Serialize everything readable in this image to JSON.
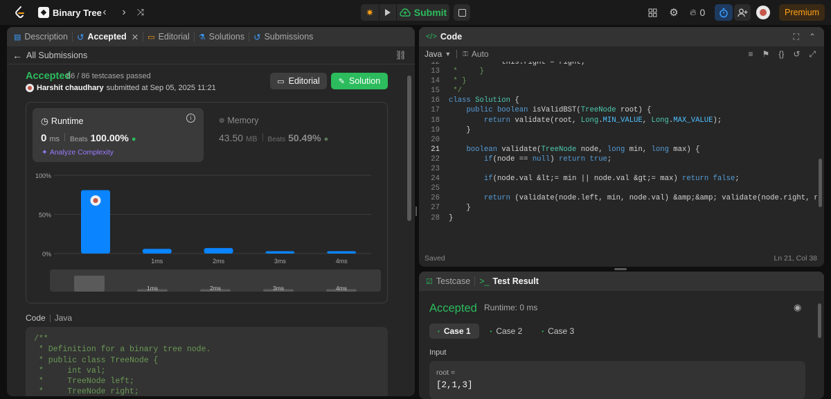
{
  "topbar": {
    "problem_title": "Binary Tree",
    "submit_label": "Submit",
    "streak_count": "0",
    "premium_label": "Premium"
  },
  "left_tabs": {
    "description": "Description",
    "accepted": "Accepted",
    "editorial": "Editorial",
    "solutions": "Solutions",
    "submissions": "Submissions"
  },
  "submission": {
    "back_label": "All Submissions",
    "status": "Accepted",
    "testcases": "86 / 86 testcases passed",
    "user_name": "Harshit chaudhary",
    "submitted_text": "submitted at Sep 05, 2025 11:21",
    "editorial_btn": "Editorial",
    "solution_btn": "Solution"
  },
  "runtime": {
    "label": "Runtime",
    "value": "0",
    "unit": "ms",
    "beats_label": "Beats",
    "beats_value": "100.00%",
    "analyze_label": "Analyze Complexity"
  },
  "memory": {
    "label": "Memory",
    "value": "43.50",
    "unit": "MB",
    "beats_label": "Beats",
    "beats_value": "50.49%"
  },
  "chart_data": {
    "type": "bar",
    "categories": [
      "0ms",
      "1ms",
      "2ms",
      "3ms",
      "4ms"
    ],
    "tick_labels": [
      "",
      "1ms",
      "2ms",
      "3ms",
      "4ms"
    ],
    "values": [
      81,
      6,
      7,
      3,
      3
    ],
    "y_ticks": [
      "100%",
      "50%",
      "0%"
    ],
    "ylim": [
      0,
      100
    ],
    "bar_color": "#0a84ff",
    "highlight_category": "0ms",
    "mini_bars": [
      20,
      3,
      3,
      3,
      3
    ],
    "mini_labels": [
      "",
      "1ms",
      "2ms",
      "3ms",
      "4ms"
    ]
  },
  "code_section": {
    "label": "Code",
    "lang": "Java",
    "lines": [
      "/**",
      " * Definition for a binary tree node.",
      " * public class TreeNode {",
      " *     int val;",
      " *     TreeNode left;",
      " *     TreeNode right;"
    ]
  },
  "editor": {
    "title": "Code",
    "language": "Java",
    "mode": "Auto",
    "partial_top": "            this.right = right;",
    "lines": [
      {
        "n": "13",
        "t": " *     }"
      },
      {
        "n": "14",
        "t": " * }"
      },
      {
        "n": "15",
        "t": " */"
      },
      {
        "n": "16",
        "t": "class Solution {"
      },
      {
        "n": "17",
        "t": "    public boolean isValidBST(TreeNode root) {"
      },
      {
        "n": "18",
        "t": "        return validate(root, Long.MIN_VALUE, Long.MAX_VALUE);"
      },
      {
        "n": "19",
        "t": "    }"
      },
      {
        "n": "20",
        "t": ""
      },
      {
        "n": "21",
        "t": "    boolean validate(TreeNode node, long min, long max) {"
      },
      {
        "n": "22",
        "t": "        if(node == null) return true;"
      },
      {
        "n": "23",
        "t": ""
      },
      {
        "n": "24",
        "t": "        if(node.val <= min || node.val >= max) return false;"
      },
      {
        "n": "25",
        "t": ""
      },
      {
        "n": "26",
        "t": "        return (validate(node.left, min, node.val) && validate(node.right, node.val, max));"
      },
      {
        "n": "27",
        "t": "    }"
      },
      {
        "n": "28",
        "t": "}"
      }
    ],
    "status_left": "Saved",
    "status_right": "Ln 21, Col 38"
  },
  "result": {
    "testcase_tab": "Testcase",
    "result_tab": "Test Result",
    "status": "Accepted",
    "runtime": "Runtime: 0 ms",
    "cases": [
      "Case 1",
      "Case 2",
      "Case 3"
    ],
    "input_label": "Input",
    "var_name": "root =",
    "var_value": "[2,1,3]"
  }
}
